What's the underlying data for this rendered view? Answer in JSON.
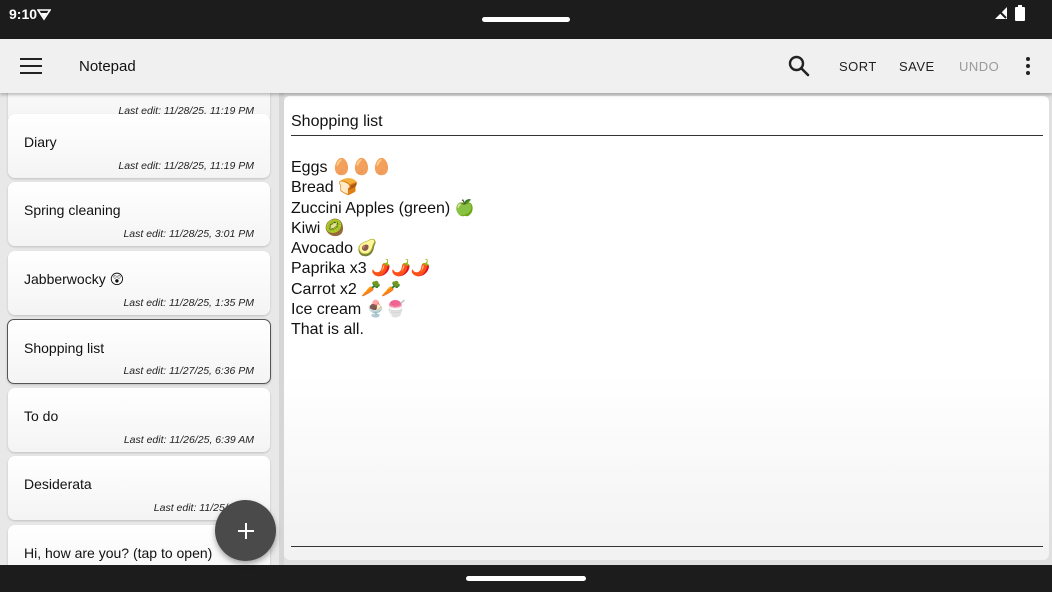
{
  "status_bar": {
    "time": "9:10"
  },
  "app_bar": {
    "title": "Notepad",
    "actions": {
      "sort": "SORT",
      "save": "SAVE",
      "undo": "UNDO"
    }
  },
  "notes": [
    {
      "title": "",
      "date": "Last edit: 11/28/25, 11:19 PM"
    },
    {
      "title": "Diary",
      "date": "Last edit: 11/28/25, 11:19 PM"
    },
    {
      "title": "Spring cleaning",
      "date": "Last edit: 11/28/25, 3:01 PM"
    },
    {
      "title": "Jabberwocky 😲",
      "date": "Last edit: 11/28/25, 1:35 PM"
    },
    {
      "title": "Shopping list",
      "date": "Last edit: 11/27/25, 6:36 PM",
      "selected": true
    },
    {
      "title": "To do",
      "date": "Last edit: 11/26/25, 6:39 AM"
    },
    {
      "title": "Desiderata",
      "date": "Last edit: 11/25/25, 8:"
    },
    {
      "title": "Hi, how are you? (tap to open)",
      "date": ""
    }
  ],
  "editor": {
    "title": "Shopping list",
    "lines": [
      "Eggs 🥚🥚🥚",
      "Bread 🍞",
      "Zuccini Apples (green) 🍏",
      "Kiwi 🥝",
      "Avocado 🥑",
      "Paprika x3 🌶️🌶️🌶️",
      "Carrot x2 🥕🥕",
      "Ice cream 🍨🍧",
      "That is all."
    ]
  },
  "icons": {
    "menu": "hamburger-menu-icon",
    "search": "search-icon",
    "more": "more-vert-icon",
    "fab": "plus-icon"
  },
  "colors": {
    "app_bar": "#f0f0f0",
    "fab": "#4a4a4a",
    "system_bar": "#1c1c1c"
  }
}
